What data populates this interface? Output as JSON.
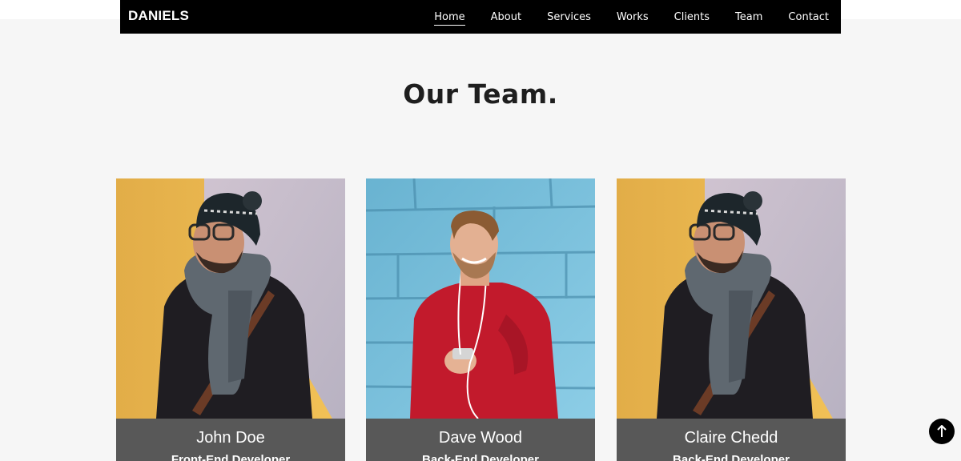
{
  "header": {
    "brand": "DANIELS",
    "nav": [
      {
        "label": "Home",
        "active": true
      },
      {
        "label": "About"
      },
      {
        "label": "Services"
      },
      {
        "label": "Works"
      },
      {
        "label": "Clients"
      },
      {
        "label": "Team"
      },
      {
        "label": "Contact"
      }
    ]
  },
  "team": {
    "title": "Our Team.",
    "members": [
      {
        "name": "John Doe",
        "role": "Front-End Developer",
        "photo": "man-in-beanie-and-scarf"
      },
      {
        "name": "Dave Wood",
        "role": "Back-End Developer",
        "photo": "man-in-red-sweater"
      },
      {
        "name": "Claire Chedd",
        "role": "Back-End Developer",
        "photo": "man-in-beanie-and-scarf"
      }
    ]
  },
  "scroll_top": {
    "icon": "arrow-up-icon"
  },
  "colors": {
    "navbar": "#000000",
    "background": "#f6f6f6",
    "card_caption": "#585858",
    "title": "#1e1e1e"
  }
}
